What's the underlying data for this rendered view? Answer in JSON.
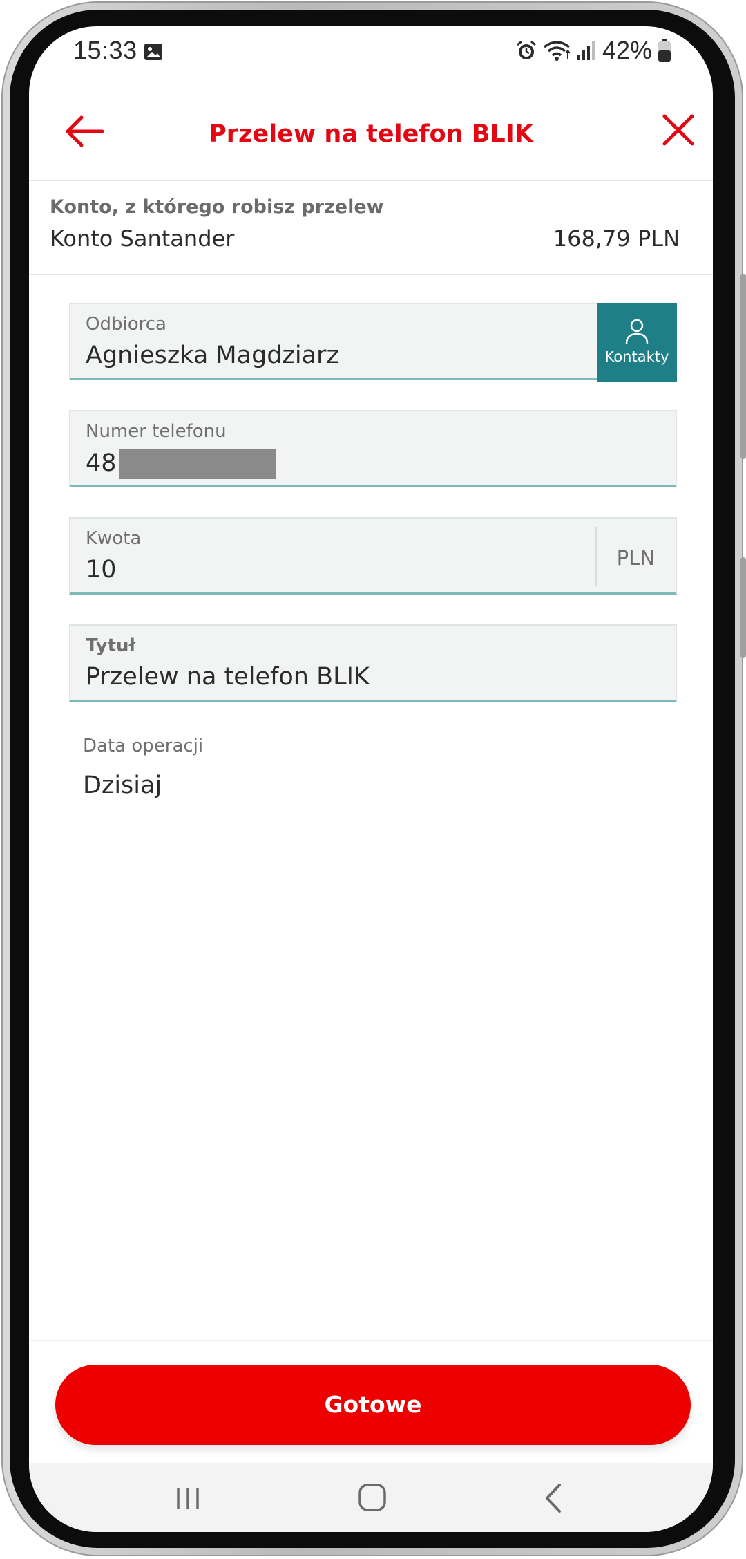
{
  "status_bar": {
    "time": "15:33",
    "battery": "42%",
    "icons": [
      "image-icon",
      "alarm-icon",
      "wifi-icon",
      "signal-icon",
      "battery-icon"
    ]
  },
  "header": {
    "title": "Przelew na telefon BLIK",
    "back_icon": "arrow-left-icon",
    "close_icon": "close-icon"
  },
  "account": {
    "label": "Konto, z którego robisz przelew",
    "name": "Konto Santander",
    "balance": "168,79 PLN"
  },
  "form": {
    "recipient": {
      "label": "Odbiorca",
      "value": "Agnieszka Magdziarz",
      "contacts_label": "Kontakty",
      "contacts_icon": "person-icon"
    },
    "phone": {
      "label": "Numer telefonu",
      "value_visible": "48"
    },
    "amount": {
      "label": "Kwota",
      "value": "10",
      "currency": "PLN"
    },
    "title": {
      "label": "Tytuł",
      "value": "Przelew na telefon BLIK"
    },
    "date": {
      "label": "Data operacji",
      "value": "Dzisiaj"
    }
  },
  "primary_action": {
    "label": "Gotowe"
  },
  "nav_bar": {
    "icons": [
      "recent-apps-icon",
      "home-icon",
      "back-icon"
    ]
  },
  "colors": {
    "brand_red": "#e30613",
    "button_red": "#ec0000",
    "teal": "#1f7f86",
    "field_bg": "#f2f4f4",
    "field_underline": "#7fb8b8"
  }
}
